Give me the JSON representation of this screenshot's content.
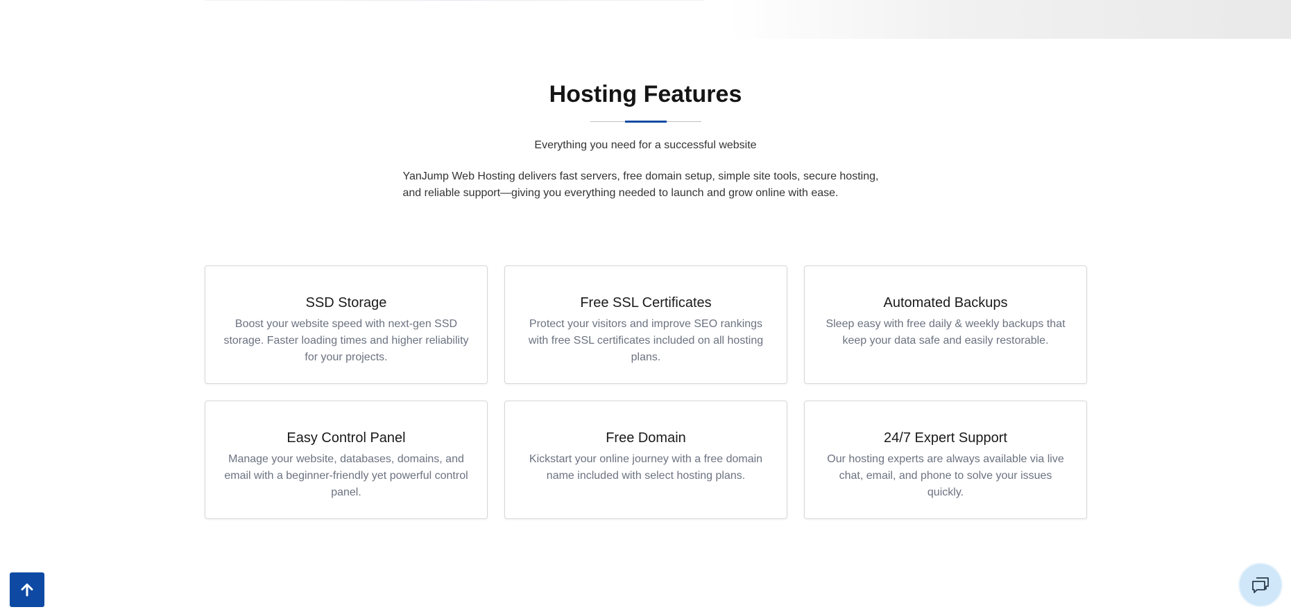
{
  "section": {
    "title": "Hosting Features",
    "subtitle": "Everything you need for a successful website",
    "description": "YanJump Web Hosting delivers fast servers, free domain setup, simple site tools, secure hosting, and reliable support—giving you everything needed to launch and grow online with ease."
  },
  "features": [
    {
      "title": "SSD Storage",
      "text": "Boost your website speed with next-gen SSD storage. Faster loading times and higher reliability for your projects."
    },
    {
      "title": "Free SSL Certificates",
      "text": "Protect your visitors and improve SEO rankings with free SSL certificates included on all hosting plans."
    },
    {
      "title": "Automated Backups",
      "text": "Sleep easy with free daily & weekly backups that keep your data safe and easily restorable."
    },
    {
      "title": "Easy Control Panel",
      "text": "Manage your website, databases, domains, and email with a beginner-friendly yet powerful control panel."
    },
    {
      "title": "Free Domain",
      "text": "Kickstart your online journey with a free domain name included with select hosting plans."
    },
    {
      "title": "24/7 Expert Support",
      "text": "Our hosting experts are always available via live chat, email, and phone to solve your issues quickly."
    }
  ],
  "widgets": {
    "scroll_top_icon": "arrow-up-icon",
    "chat_icon": "chat-bubbles-icon"
  },
  "colors": {
    "accent": "#0e4aa3",
    "card_text": "#6b7280",
    "chat_bg": "#cfe7f8"
  }
}
